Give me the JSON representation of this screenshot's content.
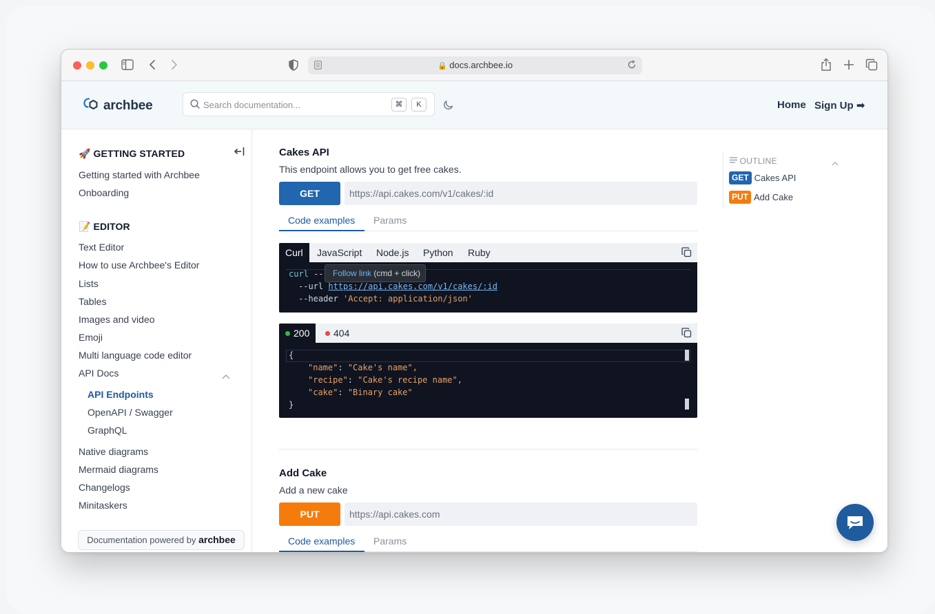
{
  "browser": {
    "url": "docs.archbee.io"
  },
  "header": {
    "logo_text": "archbee",
    "search_placeholder": "Search documentation...",
    "kbd_cmd": "⌘",
    "kbd_k": "K",
    "nav_home": "Home",
    "nav_signup": "Sign Up ➡"
  },
  "sidebar": {
    "sections": [
      {
        "title": "🚀 GETTING STARTED",
        "items": [
          "Getting started with Archbee",
          "Onboarding"
        ]
      },
      {
        "title": "📝 EDITOR",
        "items": [
          "Text Editor",
          "How to use Archbee's Editor",
          "Lists",
          "Tables",
          "Images and video",
          "Emoji",
          "Multi language code editor",
          "API Docs"
        ]
      }
    ],
    "api_docs_children": [
      "API Endpoints",
      "OpenAPI / Swagger",
      "GraphQL"
    ],
    "more_items": [
      "Native diagrams",
      "Mermaid diagrams",
      "Changelogs",
      "Minitaskers"
    ],
    "powered_prefix": "Documentation powered by",
    "powered_brand": "archbee"
  },
  "endpoints": [
    {
      "title": "Cakes API",
      "description": "This endpoint allows you to get free cakes.",
      "method": "GET",
      "url": "https://api.cakes.com/v1/cakes/:id",
      "tabs": [
        "Code examples",
        "Params"
      ]
    },
    {
      "title": "Add Cake",
      "description": "Add a new cake",
      "method": "PUT",
      "url": "https://api.cakes.com",
      "tabs": [
        "Code examples",
        "Params"
      ]
    }
  ],
  "code": {
    "languages": [
      "Curl",
      "JavaScript",
      "Node.js",
      "Python",
      "Ruby"
    ],
    "line1_cmd": "curl",
    "line1_flag": "--r",
    "line2_flag": "--url",
    "line2_url": "https://api.cakes.com/v1/cakes/:id",
    "line3_flag": "--header",
    "line3_value": "'Accept: application/json'",
    "tooltip_link": "Follow link",
    "tooltip_hint": "(cmd + click)"
  },
  "response": {
    "statuses": [
      "200",
      "404"
    ],
    "open": "{",
    "close": "}",
    "lines": [
      {
        "key": "\"name\"",
        "value": "\"Cake's name\","
      },
      {
        "key": "\"recipe\"",
        "value": "\"Cake's recipe name\","
      },
      {
        "key": "\"cake\"",
        "value": "\"Binary cake\""
      }
    ]
  },
  "outline": {
    "title": "OUTLINE",
    "items": [
      {
        "badge": "GET",
        "label": "Cakes API"
      },
      {
        "badge": "PUT",
        "label": "Add Cake"
      }
    ]
  },
  "colors": {
    "get": "#2166ae",
    "put": "#f57c0c",
    "accent": "#1e5aa0"
  }
}
